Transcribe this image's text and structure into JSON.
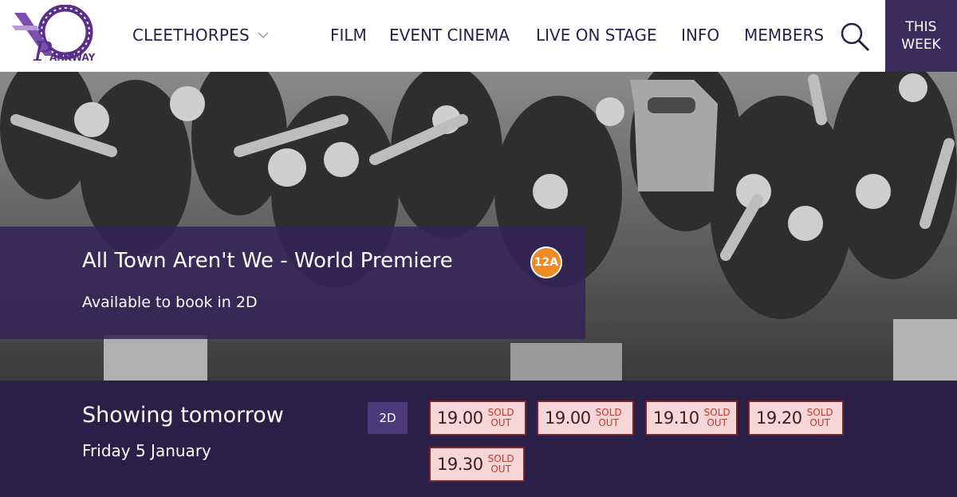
{
  "header": {
    "logo_alt": "Parkway",
    "logo_text": "ARKWAY",
    "location": "CLEETHORPES",
    "nav": [
      "FILM",
      "EVENT CINEMA",
      "LIVE ON STAGE",
      "INFO",
      "MEMBERS"
    ],
    "this_week_line1": "THIS",
    "this_week_line2": "WEEK",
    "search_icon": "search-icon"
  },
  "film": {
    "title": "All Town Aren't We - World Premiere",
    "rating": "12A",
    "availability": "Available to book in 2D"
  },
  "showtimes": {
    "heading": "Showing tomorrow",
    "date": "Friday 5 January",
    "format": "2D",
    "sold_line1": "SOLD",
    "sold_line2": "OUT",
    "slots": [
      {
        "time": "19.00",
        "status": "SOLD OUT"
      },
      {
        "time": "19.00",
        "status": "SOLD OUT"
      },
      {
        "time": "19.10",
        "status": "SOLD OUT"
      },
      {
        "time": "19.20",
        "status": "SOLD OUT"
      },
      {
        "time": "19.30",
        "status": "SOLD OUT"
      }
    ]
  },
  "colors": {
    "brand_purple": "#2a1f47",
    "this_week_bg": "#3a2d5e",
    "rating_orange": "#f08a22",
    "slot_bg": "#f7d6d8",
    "slot_border": "#7a2430",
    "sold_red": "#c0392b"
  }
}
